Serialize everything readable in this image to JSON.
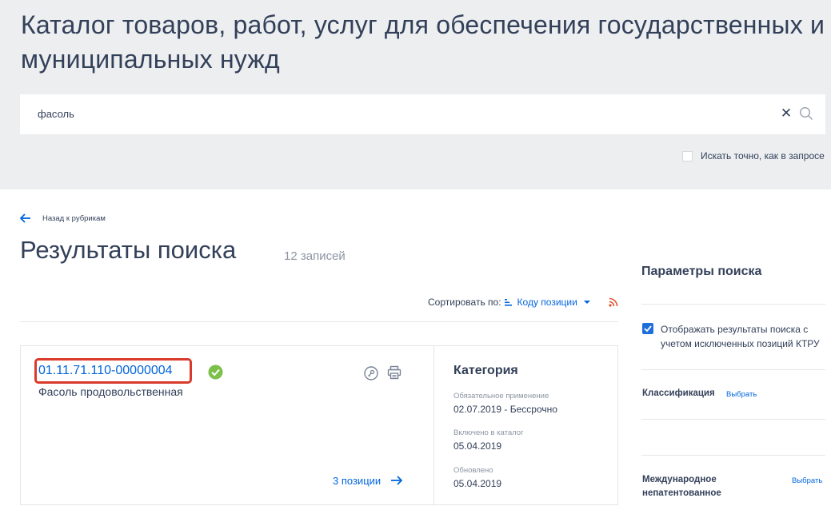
{
  "header": {
    "title": "Каталог товаров, работ, услуг для обеспечения государственных и муниципальных нужд",
    "search_value": "фасоль",
    "exact_search_label": "Искать точно, как в запросе"
  },
  "navigation": {
    "back_label": "Назад к рубрикам"
  },
  "results": {
    "title": "Результаты поиска",
    "count": "12 записей",
    "sort_label": "Сортировать по:",
    "sort_value": "Коду позиции"
  },
  "item": {
    "code": "01.11.71.110-00000004",
    "name": "Фасоль продовольственная",
    "positions_link": "3 позиции",
    "category_title": "Категория",
    "mandatory_label": "Обязательное применение",
    "mandatory_value": "02.07.2019  - Бессрочно",
    "included_label": "Включено в каталог",
    "included_value": "05.04.2019",
    "updated_label": "Обновлено",
    "updated_value": "05.04.2019"
  },
  "sidebar": {
    "title": "Параметры поиска",
    "excluded_label": "Отображать результаты поиска с учетом исключенных позиций КТРУ",
    "classification_label": "Классификация",
    "classification_link": "Выбрать",
    "inn_label_line1": "Международное",
    "inn_label_line2": "непатентованное",
    "inn_link": "Выбрать"
  },
  "colors": {
    "accent": "#0065dd",
    "highlight": "#d93a2b",
    "verified": "#7cc04b",
    "rss": "#e5532d"
  }
}
